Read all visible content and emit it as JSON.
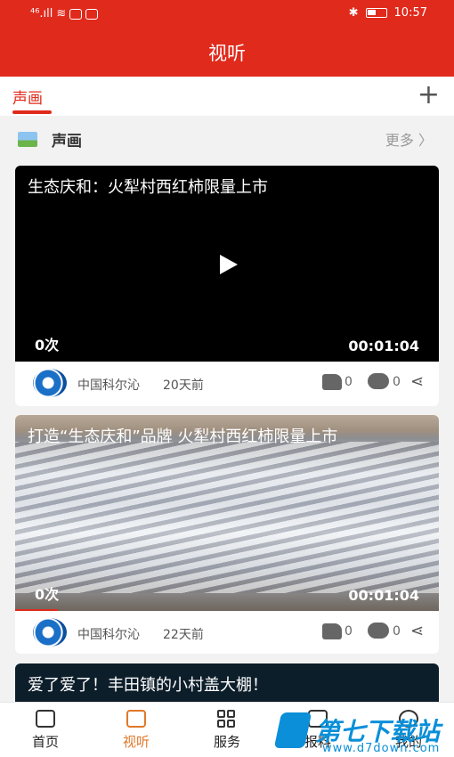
{
  "status_bar": {
    "time": "10:57",
    "signal": "⁴⁶.ıll",
    "wifi_glyph": "≋",
    "bluetooth_glyph": "✱"
  },
  "header": {
    "title": "视听"
  },
  "tabs": {
    "active": "声画",
    "add_glyph": "+"
  },
  "section": {
    "title": "声画",
    "more": "更多 〉"
  },
  "videos": [
    {
      "title": "生态庆和：火犁村西红柿限量上市",
      "views": "0次",
      "duration": "00:01:04",
      "source": "中国科尔沁",
      "ago": "20天前",
      "likes": "0",
      "comments": "0"
    },
    {
      "title": "打造“生态庆和”品牌 火犁村西红柿限量上市",
      "views": "0次",
      "duration": "00:01:04",
      "source": "中国科尔沁",
      "ago": "22天前",
      "likes": "0",
      "comments": "0"
    },
    {
      "title": "爱了爱了！丰田镇的小村盖大棚！"
    }
  ],
  "bottom_nav": [
    {
      "label": "首页",
      "icon": "home-icon"
    },
    {
      "label": "视听",
      "icon": "video-icon",
      "active": true
    },
    {
      "label": "服务",
      "icon": "grid-icon"
    },
    {
      "label": "报料",
      "icon": "speaker-icon"
    },
    {
      "label": "我的",
      "icon": "user-icon"
    }
  ],
  "watermark": {
    "name": "第七下载站",
    "url": "www.d7down.com"
  },
  "colors": {
    "brand_red": "#e02a1c",
    "nav_active": "#e0782a"
  }
}
